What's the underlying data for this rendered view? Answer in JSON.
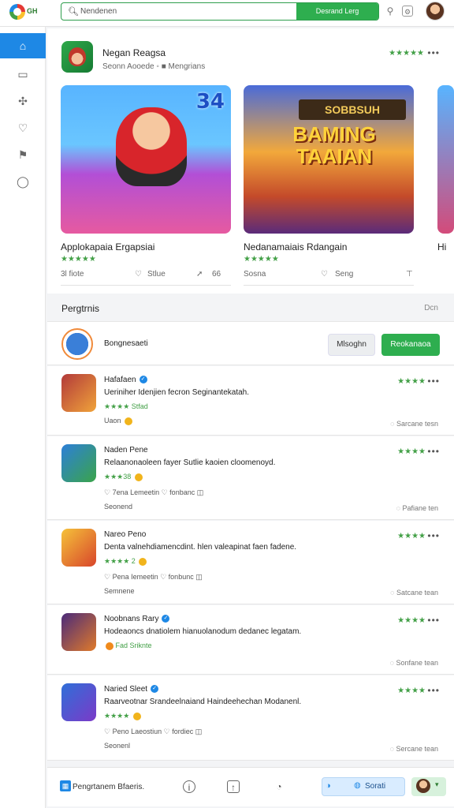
{
  "topbar": {
    "logo_text": "GH",
    "search_placeholder": "Nendenen",
    "search_button": "Desrand Lerg"
  },
  "featured": {
    "title": "Negan Reagsa",
    "meta": "Seonn Aooede  ◦  ■  Mengrians",
    "stars": "★★★★★",
    "cards": [
      {
        "name": "Applokapaia Ergapsiai",
        "stars": "★★★★★",
        "left_meta": "3l fiote",
        "right_meta": "Stlue",
        "action": "66",
        "image_text": "34"
      },
      {
        "name": "Nedanamaiais Rdangain",
        "stars": "★★★★★",
        "left_meta": "Sosna",
        "right_meta": "Seng",
        "action": "",
        "image_text": "SOBBSUH BAMING TAAIAN"
      },
      {
        "name": "Hi",
        "stars": "",
        "left_meta": "Hi",
        "right_meta": "",
        "action": "",
        "image_text": ""
      }
    ]
  },
  "section": {
    "title": "Pergtrnis",
    "link": "Dcn"
  },
  "selected": {
    "label": "Bongnesaeti",
    "btn_secondary": "Mlsoghn",
    "btn_primary": "Reokanaoa"
  },
  "apps": [
    {
      "name": "Hafafaen",
      "verified": true,
      "desc": "Ueriniher Idenjien fecron Seginantekatah.",
      "rating": "★★★★ Stfad",
      "sub": "Uaon",
      "extra": "",
      "stars": "★★★★",
      "share": "Sarcane tesn"
    },
    {
      "name": "Naden Pene",
      "verified": false,
      "desc": "Relaanonaoleen fayer Sutlie kaoien cloomenoyd.",
      "rating": "★★★38",
      "sub": "♡ 7ena Lemeetin   ♡ fonbanc   ◫",
      "extra": "Seonend",
      "stars": "★★★★",
      "share": "Pafiane ten"
    },
    {
      "name": "Nareo Peno",
      "verified": false,
      "desc": "Denta valnehdiamencdint. hlen valeapinat faen fadene.",
      "rating": "★★★★ 2",
      "sub": "♡ Pena Iemeetin   ♡ fonbunc   ◫",
      "extra": "Semnene",
      "stars": "★★★★",
      "share": "Satcane tean"
    },
    {
      "name": "Noobnans Rary",
      "verified": true,
      "desc": "Hodeaoncs dnatiolem hianuolanodum dedanec legatam.",
      "rating": "Fad Sriknte",
      "sub": "",
      "extra": "",
      "stars": "★★★★",
      "share": "Sonfane tean"
    },
    {
      "name": "Naried Sleet",
      "verified": true,
      "desc": "Raarveotnar Srandeelnaiand Haindeehechan Modanenl.",
      "rating": "★★★★",
      "sub": "♡ Peno Laeostiun   ♡ fordiec   ◫",
      "extra": "Seonenl",
      "stars": "★★★★",
      "share": "Sercane tean"
    }
  ],
  "bottom": {
    "label": "Pengrtanem Bfaeris.",
    "pill_label": "Sorati"
  },
  "colors": {
    "accent_green": "#2eae4f",
    "accent_blue": "#1e88e5"
  }
}
